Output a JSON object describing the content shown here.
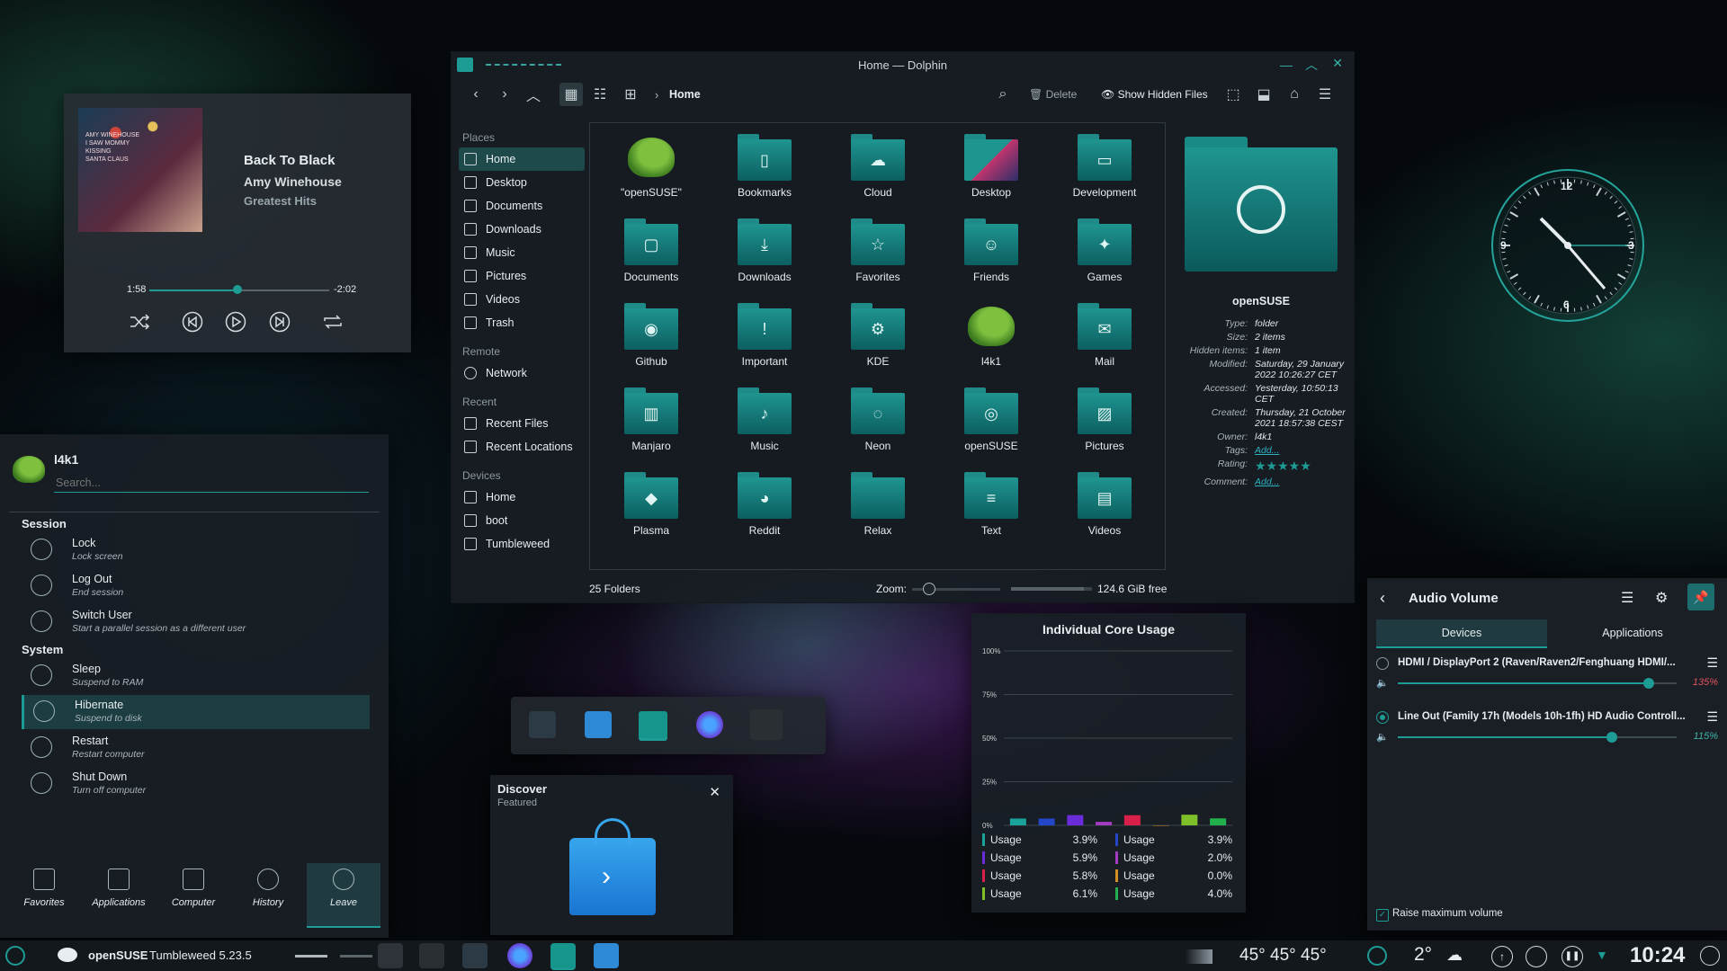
{
  "colors": {
    "accent": "#1d9b95",
    "selection": "#1e4a4c",
    "link": "#2bb3c0",
    "percent_red": "#e0525d",
    "percent_teal": "#3db3a6"
  },
  "media": {
    "title": "Back To Black",
    "artist": "Amy Winehouse",
    "album": "Greatest Hits",
    "elapsed": "1:58",
    "remaining": "-2:02",
    "progress": 0.49,
    "album_art_text": [
      "AMY WINEHOUSE",
      "I SAW MOMMY",
      "KISSING",
      "SANTA CLAUS"
    ],
    "controls": [
      "shuffle-icon",
      "previous-icon",
      "play-icon",
      "next-icon",
      "repeat-icon"
    ]
  },
  "dolphin": {
    "window_title": "Home — Dolphin",
    "toolbar": {
      "breadcrumb_sep": "›",
      "breadcrumb": "Home",
      "delete_label": "Delete",
      "hidden_label": "Show Hidden Files"
    },
    "places": {
      "places_head": "Places",
      "places": [
        "Home",
        "Desktop",
        "Documents",
        "Downloads",
        "Music",
        "Pictures",
        "Videos",
        "Trash"
      ],
      "remote_head": "Remote",
      "remote": [
        "Network"
      ],
      "recent_head": "Recent",
      "recent": [
        "Recent Files",
        "Recent Locations"
      ],
      "devices_head": "Devices",
      "devices": [
        "Home",
        "boot",
        "Tumbleweed"
      ]
    },
    "folders": [
      "\"openSUSE\"",
      "Bookmarks",
      "Cloud",
      "Desktop",
      "Development",
      "Documents",
      "Downloads",
      "Favorites",
      "Friends",
      "Games",
      "Github",
      "Important",
      "KDE",
      "l4k1",
      "Mail",
      "Manjaro",
      "Music",
      "Neon",
      "openSUSE",
      "Pictures",
      "Plasma",
      "Reddit",
      "Relax",
      "Text",
      "Videos"
    ],
    "info": {
      "name": "openSUSE",
      "rows": [
        [
          "Type:",
          "folder"
        ],
        [
          "Size:",
          "2 items"
        ],
        [
          "Hidden items:",
          "1 item"
        ],
        [
          "Modified:",
          "Saturday, 29 January 2022 10:26:27 CET"
        ],
        [
          "Accessed:",
          "Yesterday, 10:50:13 CET"
        ],
        [
          "Created:",
          "Thursday, 21 October 2021 18:57:38 CEST"
        ],
        [
          "Owner:",
          "l4k1"
        ],
        [
          "Tags:",
          "Add..."
        ],
        [
          "Rating:",
          "★★★★★"
        ],
        [
          "Comment:",
          "Add..."
        ]
      ]
    },
    "status": {
      "count": "25 Folders",
      "zoom_label": "Zoom:",
      "free": "124.6 GiB free",
      "free_fraction": 0.9
    }
  },
  "kickoff": {
    "user": "l4k1",
    "search_placeholder": "Search...",
    "session_head": "Session",
    "system_head": "System",
    "session": [
      {
        "t": "Lock",
        "s": "Lock screen"
      },
      {
        "t": "Log Out",
        "s": "End session"
      },
      {
        "t": "Switch User",
        "s": "Start a parallel session as a different user"
      }
    ],
    "system": [
      {
        "t": "Sleep",
        "s": "Suspend to RAM"
      },
      {
        "t": "Hibernate",
        "s": "Suspend to disk"
      },
      {
        "t": "Restart",
        "s": "Restart computer"
      },
      {
        "t": "Shut Down",
        "s": "Turn off computer"
      }
    ],
    "tabs": [
      "Favorites",
      "Applications",
      "Computer",
      "History",
      "Leave"
    ]
  },
  "clock": {
    "numerals": [
      "12",
      "3",
      "6",
      "9"
    ]
  },
  "core": {
    "title": "Individual Core Usage",
    "legend_label": "Usage",
    "left": [
      [
        "3.9%",
        "#1aa39b"
      ],
      [
        "5.9%",
        "#6a2bd8"
      ],
      [
        "5.8%",
        "#d8204a"
      ],
      [
        "6.1%",
        "#7ebf2a"
      ]
    ],
    "right": [
      [
        "3.9%",
        "#2446c9"
      ],
      [
        "2.0%",
        "#a43cc2"
      ],
      [
        "0.0%",
        "#d39020"
      ],
      [
        "4.0%",
        "#22b04c"
      ]
    ]
  },
  "chart_data": {
    "type": "bar",
    "title": "Individual Core Usage",
    "yticks": [
      "100%",
      "75%",
      "50%",
      "25%",
      "0%"
    ],
    "ylim": [
      0,
      100
    ],
    "series": [
      {
        "name": "Usage",
        "values": [
          3.9,
          3.9,
          5.9,
          2.0,
          5.8,
          0.0,
          6.1,
          4.0
        ],
        "colors": [
          "#1aa39b",
          "#2446c9",
          "#6a2bd8",
          "#a43cc2",
          "#d8204a",
          "#d39020",
          "#7ebf2a",
          "#22b04c"
        ]
      }
    ]
  },
  "discover": {
    "title": "Discover",
    "subtitle": "Featured",
    "close": "✕"
  },
  "audio": {
    "title": "Audio Volume",
    "tab_devices": "Devices",
    "tab_apps": "Applications",
    "devices": [
      {
        "name": "HDMI / DisplayPort 2 (Raven/Raven2/Fenghuang HDMI/...",
        "pct": "135%",
        "level": 1.35,
        "color": "#e0525d",
        "selected": false
      },
      {
        "name": "Line Out (Family 17h (Models 10h-1fh) HD Audio Controll...",
        "pct": "115%",
        "level": 1.15,
        "color": "#3db3a6",
        "selected": true
      }
    ],
    "raise_label": "Raise maximum volume"
  },
  "taskbar": {
    "os": "openSUSE",
    "version": "Tumbleweed 5.23.5",
    "temps": "45° 45° 45°",
    "weather": "2°",
    "time": "10:24"
  }
}
